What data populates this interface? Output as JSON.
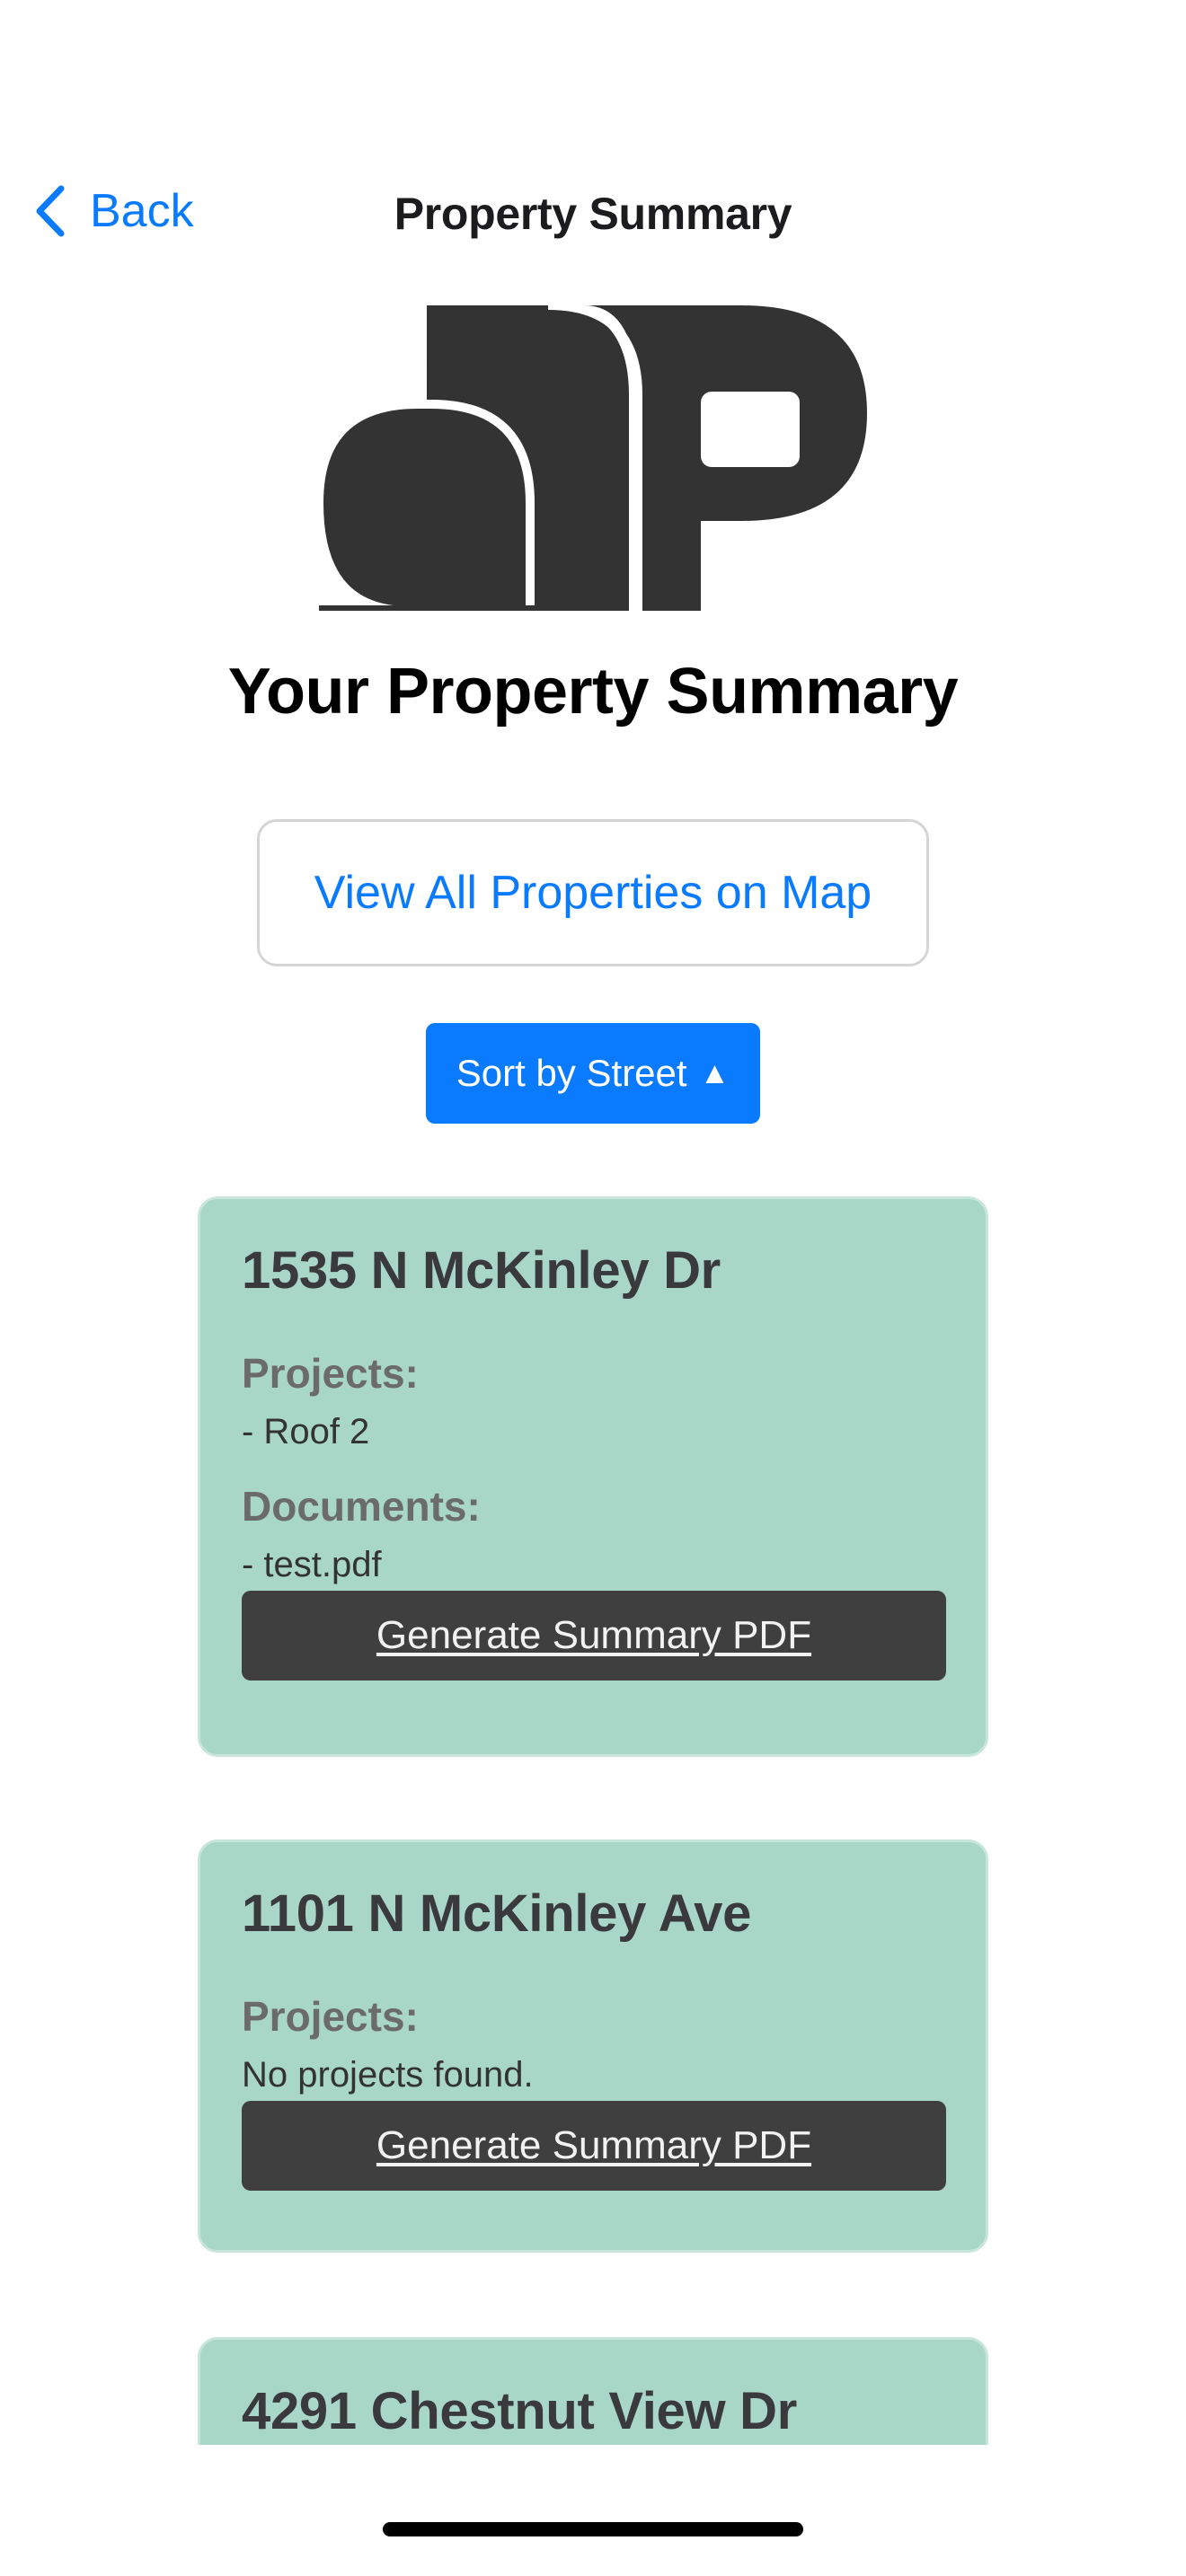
{
  "nav": {
    "back_label": "Back",
    "title": "Property Summary"
  },
  "logo": {
    "icon": "ap-logo",
    "color": "#333333"
  },
  "heading": "Your Property Summary",
  "map_button": {
    "label": "View All Properties on Map"
  },
  "sort_button": {
    "label": "Sort by Street",
    "arrow": "▲"
  },
  "cards": [
    {
      "address": "1535 N McKinley Dr",
      "projects_label": "Projects:",
      "projects": [
        "- Roof 2"
      ],
      "documents_label": "Documents:",
      "documents": [
        "- test.pdf"
      ],
      "button_label": "Generate Summary PDF"
    },
    {
      "address": "1101 N McKinley Ave",
      "projects_label": "Projects:",
      "projects_empty": "No projects found.",
      "button_label": "Generate Summary PDF"
    },
    {
      "address": "4291 Chestnut View Dr"
    }
  ],
  "colors": {
    "accent": "#0a7aff",
    "card_background": "#a8d6c7",
    "pdf_button": "#3f3f3f"
  }
}
